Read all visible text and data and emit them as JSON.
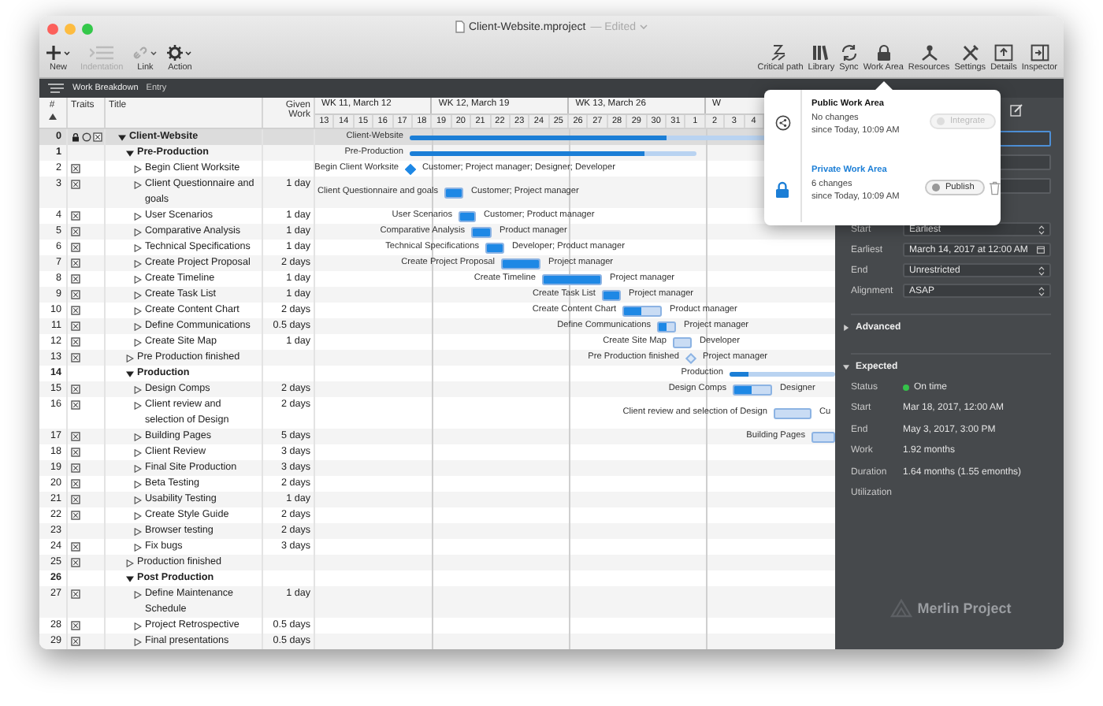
{
  "window": {
    "title": "Client-Website.mproject",
    "edited": "— Edited"
  },
  "toolbar": {
    "left": [
      {
        "label": "New",
        "kind": "new",
        "disabled": false
      },
      {
        "label": "Indentation",
        "kind": "indent",
        "disabled": true
      },
      {
        "label": "Link",
        "kind": "link",
        "disabled": false
      },
      {
        "label": "Action",
        "kind": "action",
        "disabled": false
      }
    ],
    "right": [
      {
        "label": "Critical path",
        "kind": "critical"
      },
      {
        "label": "Library",
        "kind": "library"
      },
      {
        "label": "Sync",
        "kind": "sync"
      },
      {
        "label": "Work Area",
        "kind": "workarea"
      },
      {
        "label": "Resources",
        "kind": "resources"
      },
      {
        "label": "Settings",
        "kind": "settings"
      },
      {
        "label": "Details",
        "kind": "details"
      },
      {
        "label": "Inspector",
        "kind": "inspector"
      }
    ]
  },
  "breadcrumb": {
    "view": "Work Breakdown",
    "mode": "Entry"
  },
  "table": {
    "columns": [
      "#",
      "Traits",
      "Title",
      "Given Work"
    ],
    "rows": [
      {
        "num": "0",
        "title": "Client-Website",
        "expanded": true,
        "traits": [
          {
            "kind": "lock"
          },
          {
            "kind": "clock"
          },
          {
            "kind": "check"
          }
        ],
        "bar": {
          "kind": "summary",
          "label": "Client-Website",
          "level": 0.68
        },
        "children": [
          {
            "num": "1",
            "title": "Pre-Production",
            "expanded": true,
            "bar": {
              "kind": "summary",
              "label": "Pre-Production",
              "level": 0.82
            },
            "children": [
              {
                "num": "2",
                "title": "Begin Client Worksite",
                "expanded": false,
                "traits": [
                  {
                    "kind": "check"
                  }
                ],
                "bar": {
                  "kind": "milestone",
                  "label": "Begin Client Worksite",
                  "resources": "Customer; Project manager; Designer; Developer",
                  "done": true
                }
              },
              {
                "num": "3",
                "title": "Client Questionnaire and goals",
                "work": "1 day",
                "expanded": false,
                "traits": [
                  {
                    "kind": "check"
                  }
                ],
                "bar": {
                  "kind": "task",
                  "label": "Client Questionnaire and goals",
                  "resources": "Customer; Project manager",
                  "level": 1
                }
              },
              {
                "num": "4",
                "title": "User Scenarios",
                "work": "1 day",
                "expanded": false,
                "traits": [
                  {
                    "kind": "check"
                  }
                ],
                "bar": {
                  "kind": "task",
                  "label": "User Scenarios",
                  "resources": "Customer; Product manager",
                  "level": 1
                }
              },
              {
                "num": "5",
                "title": "Comparative Analysis",
                "work": "1 day",
                "expanded": false,
                "traits": [
                  {
                    "kind": "check"
                  }
                ],
                "bar": {
                  "kind": "task",
                  "label": "Comparative Analysis",
                  "resources": "Product manager",
                  "level": 1
                }
              },
              {
                "num": "6",
                "title": "Technical Specifications",
                "work": "1 day",
                "expanded": false,
                "traits": [
                  {
                    "kind": "check"
                  }
                ],
                "bar": {
                  "kind": "task",
                  "label": "Technical Specifications",
                  "resources": "Developer; Product manager",
                  "level": 1
                }
              },
              {
                "num": "7",
                "title": "Create Project Proposal",
                "work": "2 days",
                "expanded": false,
                "traits": [
                  {
                    "kind": "check"
                  }
                ],
                "bar": {
                  "kind": "task",
                  "label": "Create Project Proposal",
                  "resources": "Project manager",
                  "level": 1
                }
              },
              {
                "num": "8",
                "title": "Create Timeline",
                "work": "1 day",
                "expanded": false,
                "traits": [
                  {
                    "kind": "check"
                  }
                ],
                "bar": {
                  "kind": "task",
                  "label": "Create Timeline",
                  "resources": "Project manager",
                  "level": 1
                }
              },
              {
                "num": "9",
                "title": "Create Task List",
                "work": "1 day",
                "expanded": false,
                "traits": [
                  {
                    "kind": "check"
                  }
                ],
                "bar": {
                  "kind": "task",
                  "label": "Create Task List",
                  "resources": "Project manager",
                  "level": 1
                }
              },
              {
                "num": "10",
                "title": "Create Content Chart",
                "work": "2 days",
                "expanded": false,
                "traits": [
                  {
                    "kind": "check"
                  }
                ],
                "bar": {
                  "kind": "task",
                  "label": "Create Content Chart",
                  "resources": "Product manager",
                  "level": 0.48
                }
              },
              {
                "num": "11",
                "title": "Define Communications",
                "work": "0.5 days",
                "expanded": false,
                "traits": [
                  {
                    "kind": "check"
                  }
                ],
                "bar": {
                  "kind": "task",
                  "label": "Define Communications",
                  "resources": "Project manager",
                  "level": 0.5
                }
              },
              {
                "num": "12",
                "title": "Create Site Map",
                "work": "1 day",
                "expanded": false,
                "traits": [
                  {
                    "kind": "check"
                  }
                ],
                "bar": {
                  "kind": "task",
                  "label": "Create Site Map",
                  "resources": "Developer"
                }
              }
            ]
          },
          {
            "num": "13",
            "title": "Pre Production finished",
            "expanded": false,
            "traits": [
              {
                "kind": "check"
              }
            ],
            "bar": {
              "kind": "milestone",
              "label": "Pre Production finished",
              "resources": "Project manager",
              "done": false
            }
          },
          {
            "num": "14",
            "title": "Production",
            "expanded": true,
            "bar": {
              "kind": "summary",
              "label": "Production",
              "level": 0.18
            },
            "children": [
              {
                "num": "15",
                "title": "Design Comps",
                "work": "2 days",
                "expanded": false,
                "traits": [
                  {
                    "kind": "check"
                  }
                ],
                "bar": {
                  "kind": "task",
                  "label": "Design Comps",
                  "resources": "Designer",
                  "level": 0.48
                }
              },
              {
                "num": "16",
                "title": "Client review and selection of Design",
                "work": "2 days",
                "expanded": false,
                "traits": [
                  {
                    "kind": "check"
                  }
                ],
                "bar": {
                  "kind": "task",
                  "label": "Client review and selection of Design",
                  "resources": "Cu"
                }
              },
              {
                "num": "17",
                "title": "Building Pages",
                "work": "5 days",
                "expanded": false,
                "traits": [
                  {
                    "kind": "check"
                  }
                ],
                "bar": {
                  "kind": "task",
                  "label": "Building Pages"
                }
              },
              {
                "num": "18",
                "title": "Client Review",
                "work": "3 days",
                "expanded": false,
                "traits": [
                  {
                    "kind": "check"
                  }
                ]
              },
              {
                "num": "19",
                "title": "Final Site Production",
                "work": "3 days",
                "expanded": false,
                "traits": [
                  {
                    "kind": "check"
                  }
                ]
              },
              {
                "num": "20",
                "title": "Beta Testing",
                "work": "2 days",
                "expanded": false,
                "traits": [
                  {
                    "kind": "check"
                  }
                ]
              },
              {
                "num": "21",
                "title": "Usability Testing",
                "work": "1 day",
                "expanded": false,
                "traits": [
                  {
                    "kind": "check"
                  }
                ]
              },
              {
                "num": "22",
                "title": "Create Style Guide",
                "work": "2 days",
                "expanded": false,
                "traits": [
                  {
                    "kind": "check"
                  }
                ]
              },
              {
                "num": "23",
                "title": "Browser testing",
                "work": "2 days",
                "expanded": false
              },
              {
                "num": "24",
                "title": "Fix bugs",
                "work": "3 days",
                "expanded": false,
                "traits": [
                  {
                    "kind": "check"
                  }
                ]
              }
            ]
          },
          {
            "num": "25",
            "title": "Production finished",
            "expanded": false,
            "traits": [
              {
                "kind": "check"
              }
            ]
          },
          {
            "num": "26",
            "title": "Post Production",
            "expanded": true,
            "children": [
              {
                "num": "27",
                "title": "Define Maintenance Schedule",
                "work": "1 day",
                "expanded": false,
                "traits": [
                  {
                    "kind": "check"
                  }
                ]
              },
              {
                "num": "28",
                "title": "Project Retrospective",
                "work": "0.5 days",
                "expanded": false,
                "traits": [
                  {
                    "kind": "check"
                  }
                ]
              },
              {
                "num": "29",
                "title": "Final presentations",
                "work": "0.5 days",
                "expanded": false,
                "traits": [
                  {
                    "kind": "check"
                  }
                ]
              }
            ]
          }
        ]
      }
    ]
  },
  "timeline": {
    "weeks": [
      "WK 11, March 12",
      "WK 12, March 19",
      "WK 13, March 26",
      "W"
    ],
    "days": [
      "13",
      "14",
      "15",
      "16",
      "17",
      "18",
      "19",
      "20",
      "21",
      "22",
      "23",
      "24",
      "25",
      "26",
      "27",
      "28",
      "29",
      "30",
      "31",
      "1",
      "2",
      "3",
      "4"
    ]
  },
  "work_area_popover": {
    "areas": [
      {
        "kind": "public",
        "title": "Public Work Area",
        "changes": "No changes",
        "since": "since Today, 10:09 AM",
        "button": {
          "label": "Integrate",
          "disabled": true
        }
      },
      {
        "kind": "private",
        "title": "Private Work Area",
        "changes": "6 changes",
        "since": "since Today, 10:09 AM",
        "button": {
          "label": "Publish",
          "disabled": false
        },
        "discard": true
      }
    ]
  },
  "inspector": {
    "constraints": [
      {
        "label": "Start",
        "value": "Earliest",
        "kind": "select"
      },
      {
        "label": "Earliest",
        "value": "March 14, 2017 at 12:00 AM",
        "kind": "date"
      },
      {
        "label": "End",
        "value": "Unrestricted",
        "kind": "select"
      },
      {
        "label": "Alignment",
        "value": "ASAP",
        "kind": "select"
      }
    ],
    "sections": [
      {
        "title": "Advanced",
        "expanded": false
      },
      {
        "title": "Expected",
        "expanded": true,
        "items": [
          {
            "label": "Status",
            "value": "On time",
            "kind": "status"
          },
          {
            "label": "Start",
            "value": "Mar 18, 2017, 12:00 AM",
            "kind": "text"
          },
          {
            "label": "End",
            "value": "May 3, 2017, 3:00 PM",
            "kind": "text"
          },
          {
            "label": "Work",
            "value": "1.92 months",
            "kind": "text"
          },
          {
            "label": "Duration",
            "value": "1.64 months (1.55 emonths)",
            "kind": "text"
          },
          {
            "label": "Utilization",
            "kind": "text"
          }
        ]
      }
    ],
    "logo": "Merlin Project"
  }
}
